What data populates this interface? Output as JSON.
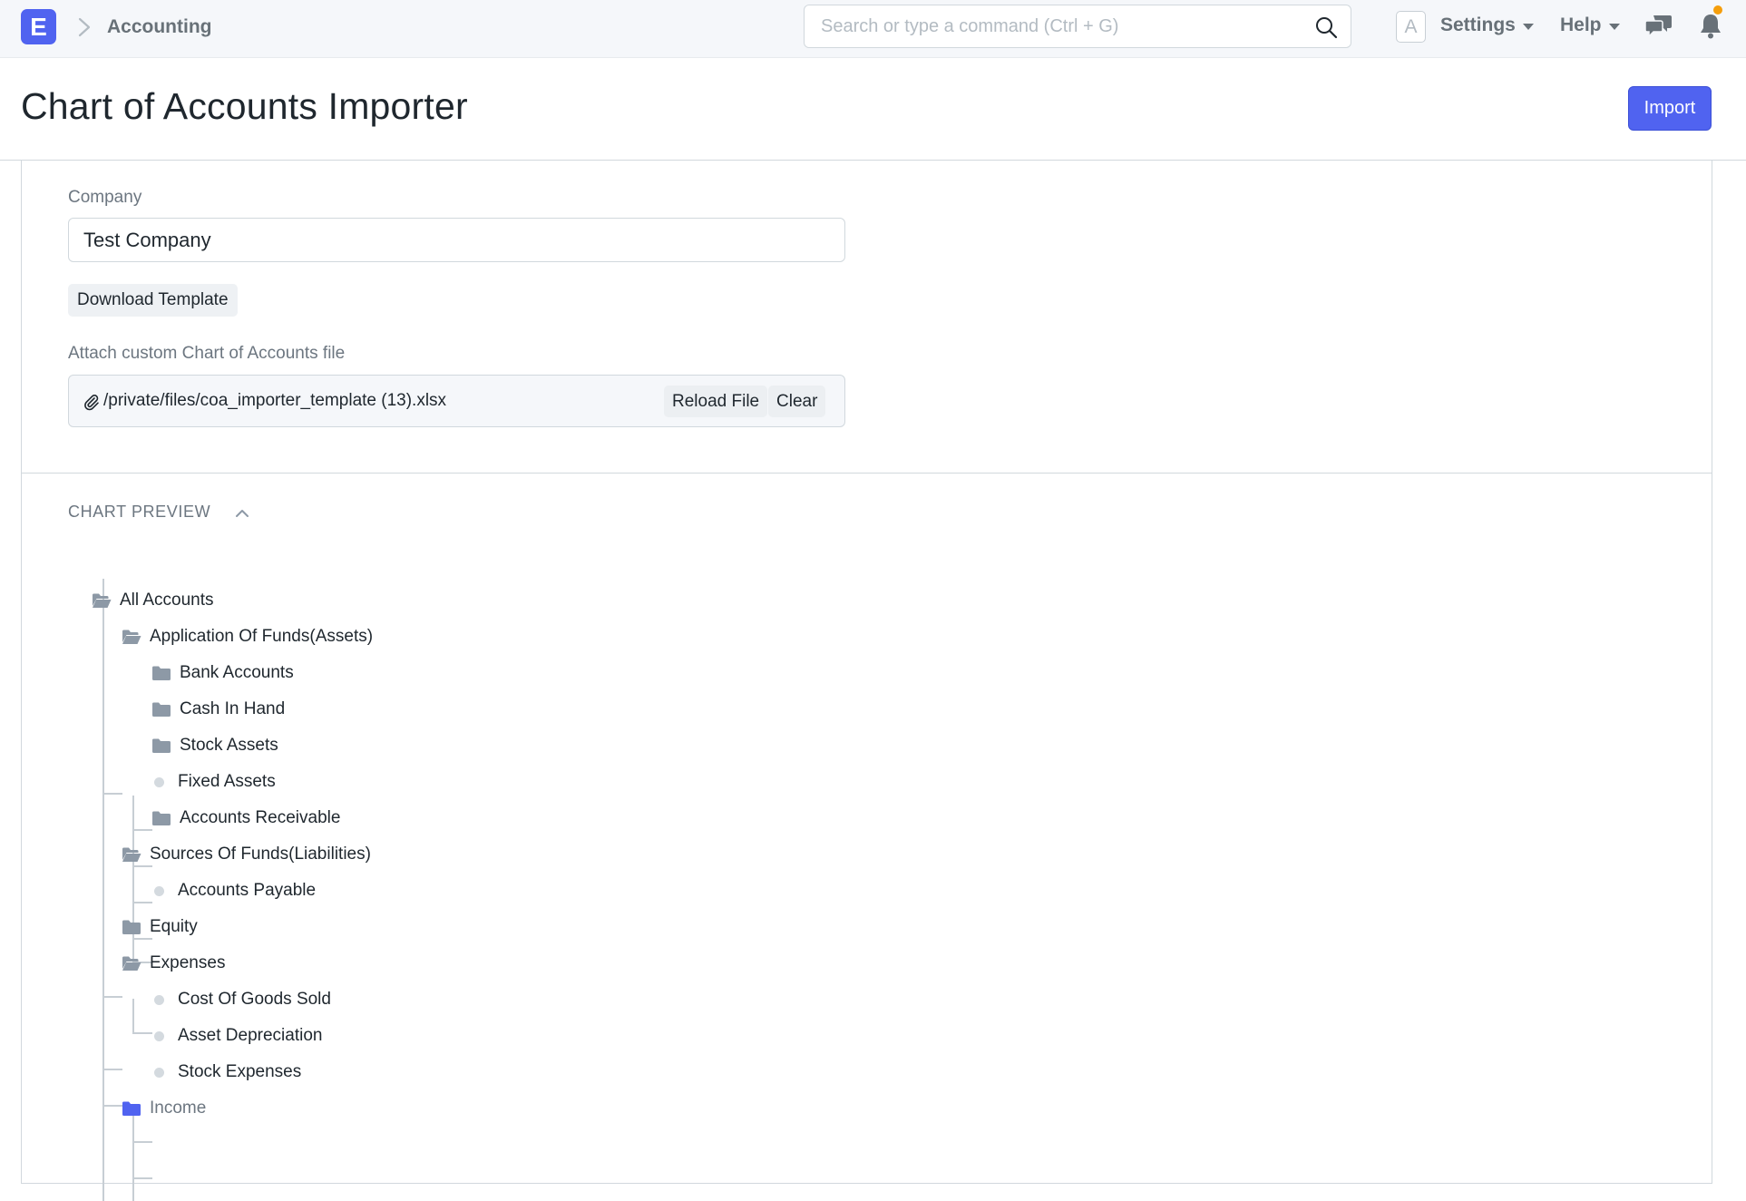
{
  "navbar": {
    "logo_letter": "E",
    "breadcrumb": "Accounting",
    "search_placeholder": "Search or type a command (Ctrl + G)",
    "avatar_letter": "A",
    "settings_label": "Settings",
    "help_label": "Help"
  },
  "page": {
    "title": "Chart of Accounts Importer",
    "primary_action": "Import"
  },
  "form": {
    "company_label": "Company",
    "company_value": "Test Company",
    "download_template_label": "Download Template",
    "attach_label": "Attach custom Chart of Accounts file",
    "attach_path": "/private/files/coa_importer_template (13).xlsx",
    "reload_label": "Reload File",
    "clear_label": "Clear"
  },
  "preview": {
    "section_title": "CHART PREVIEW",
    "tree": [
      {
        "label": "All Accounts",
        "type": "folder-open"
      },
      {
        "label": "Application Of Funds(Assets)",
        "type": "folder-open"
      },
      {
        "label": "Bank Accounts",
        "type": "folder"
      },
      {
        "label": "Cash In Hand",
        "type": "folder"
      },
      {
        "label": "Stock Assets",
        "type": "folder"
      },
      {
        "label": "Fixed Assets",
        "type": "leaf"
      },
      {
        "label": "Accounts Receivable",
        "type": "folder"
      },
      {
        "label": "Sources Of Funds(Liabilities)",
        "type": "folder-open"
      },
      {
        "label": "Accounts Payable",
        "type": "leaf"
      },
      {
        "label": "Equity",
        "type": "folder"
      },
      {
        "label": "Expenses",
        "type": "folder-open"
      },
      {
        "label": "Cost Of Goods Sold",
        "type": "leaf"
      },
      {
        "label": "Asset Depreciation",
        "type": "leaf"
      },
      {
        "label": "Stock Expenses",
        "type": "leaf"
      },
      {
        "label": "Income",
        "type": "folder-selected"
      }
    ]
  },
  "colors": {
    "primary": "#5063f0",
    "folder": "#8d99a6",
    "notification_dot": "#f59e0b"
  }
}
